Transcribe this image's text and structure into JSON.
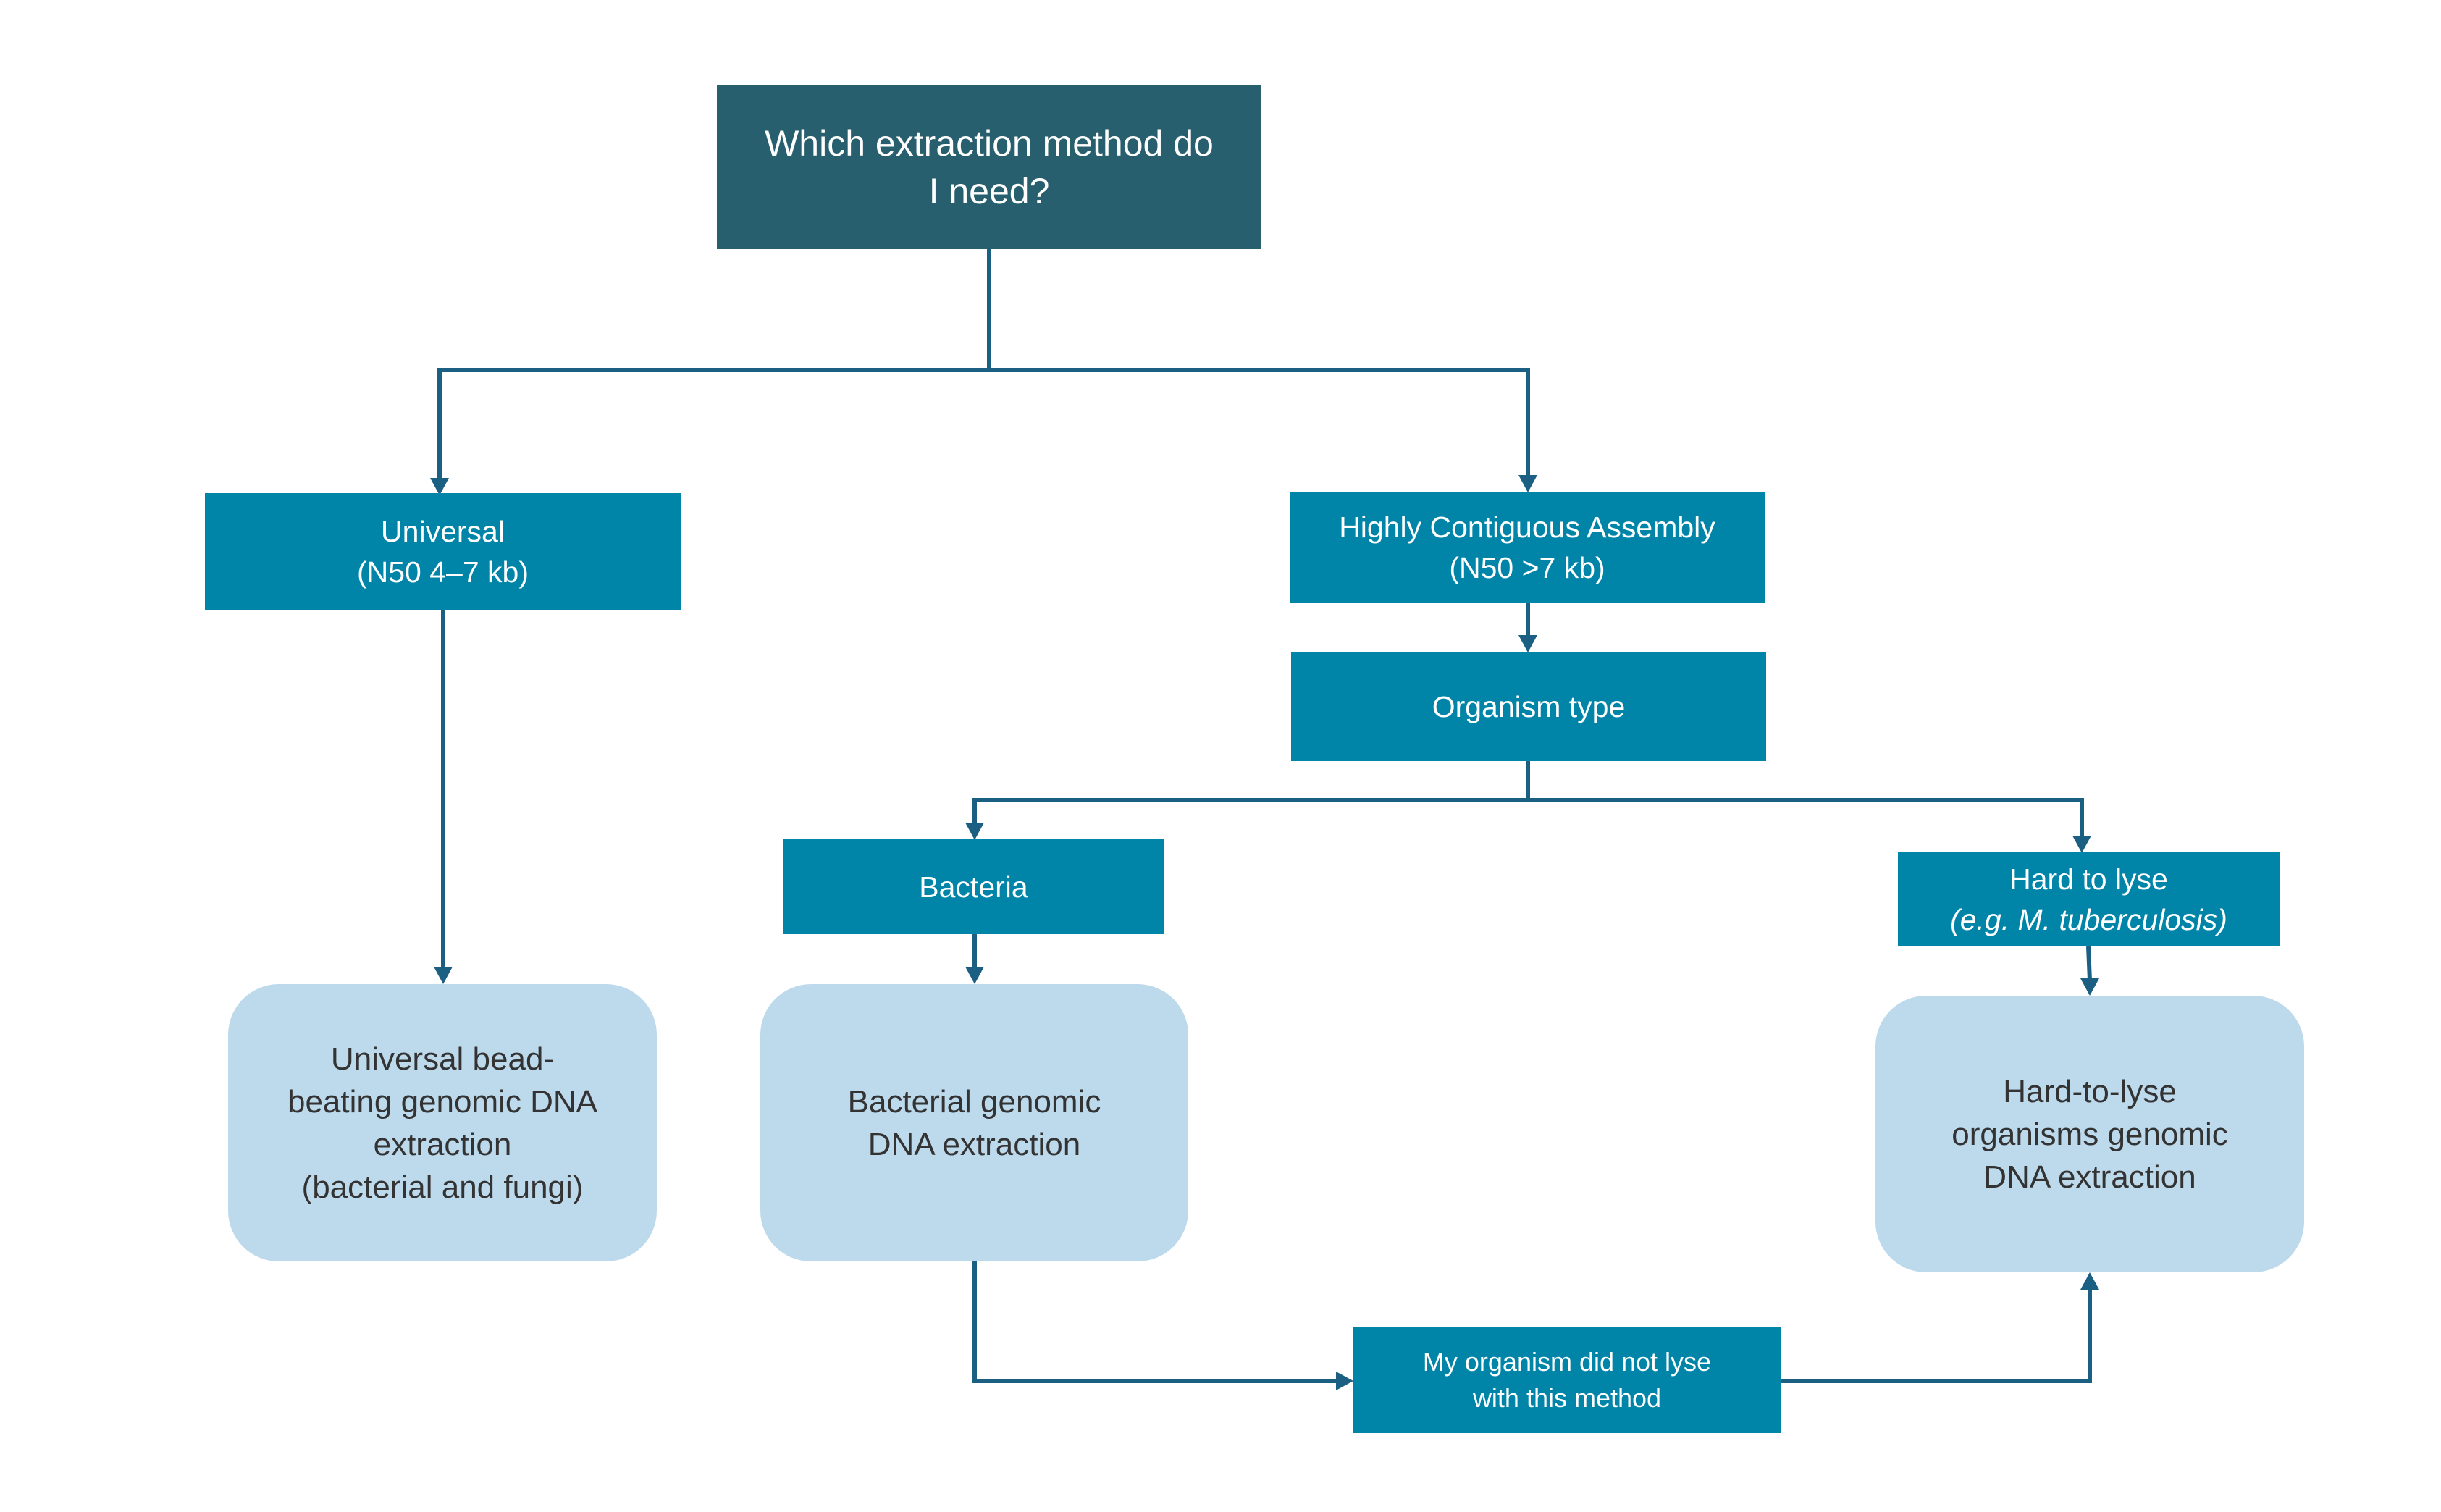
{
  "diagram": {
    "type": "flowchart",
    "colors": {
      "root_box": "#285F6E",
      "decision_box": "#0085A9",
      "result_box": "#BDD9EC",
      "connector": "#1B5F82",
      "light_text": "#FFFFFF",
      "dark_text": "#333333"
    },
    "nodes": {
      "root": {
        "lines": [
          "Which extraction method do",
          "I need?"
        ]
      },
      "universal": {
        "lines": [
          "Universal",
          "(N50 4–7 kb)"
        ]
      },
      "highly_contiguous": {
        "lines": [
          "Highly Contiguous Assembly",
          "(N50 >7 kb)"
        ]
      },
      "organism_type": {
        "lines": [
          "Organism type"
        ]
      },
      "bacteria": {
        "lines": [
          "Bacteria"
        ]
      },
      "hard_to_lyse": {
        "lines": [
          "Hard to lyse",
          "(e.g. M. tuberculosis)"
        ]
      },
      "universal_method": {
        "lines": [
          "Universal bead-",
          "beating genomic DNA",
          "extraction",
          "(bacterial and fungi)"
        ]
      },
      "bacterial_method": {
        "lines": [
          "Bacterial genomic",
          "DNA extraction"
        ]
      },
      "hard_to_lyse_method": {
        "lines": [
          "Hard-to-lyse",
          "organisms genomic",
          "DNA extraction"
        ]
      },
      "did_not_lyse": {
        "lines": [
          "My organism did not lyse",
          "with this method"
        ]
      }
    },
    "edges": [
      {
        "from": "root",
        "to": "universal"
      },
      {
        "from": "root",
        "to": "highly_contiguous"
      },
      {
        "from": "universal",
        "to": "universal_method"
      },
      {
        "from": "highly_contiguous",
        "to": "organism_type"
      },
      {
        "from": "organism_type",
        "to": "bacteria"
      },
      {
        "from": "organism_type",
        "to": "hard_to_lyse"
      },
      {
        "from": "bacteria",
        "to": "bacterial_method"
      },
      {
        "from": "hard_to_lyse",
        "to": "hard_to_lyse_method"
      },
      {
        "from": "bacterial_method",
        "to": "did_not_lyse"
      },
      {
        "from": "did_not_lyse",
        "to": "hard_to_lyse_method"
      }
    ]
  }
}
